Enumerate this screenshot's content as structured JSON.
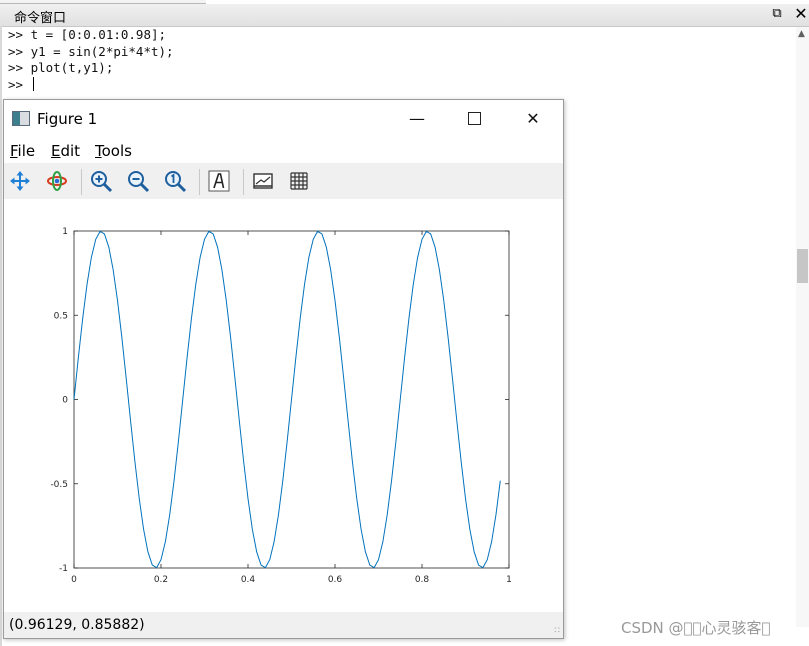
{
  "command_window": {
    "title": "命令窗口",
    "lines": [
      ">> t = [0:0.01:0.98];",
      ">> y1 = sin(2*pi*4*t);",
      ">> plot(t,y1);",
      ">> "
    ],
    "close_glyph": "✕"
  },
  "figure": {
    "title": "Figure 1",
    "menu": {
      "file": "File",
      "edit": "Edit",
      "tools": "Tools"
    },
    "toolbar": [
      "pan-icon",
      "rotate-icon",
      "zoom-in-icon",
      "zoom-out-icon",
      "zoom-reset-icon",
      "insert-text-icon",
      "toggle-axes-icon",
      "toggle-grid-icon"
    ],
    "status": "(0.96129, 0.85882)",
    "line_color": "#0072bd"
  },
  "watermark": "CSDN @\u0000\u0000心灵骇客\u0000",
  "chart_data": {
    "type": "line",
    "expression": "y1 = sin(2*pi*4*t)",
    "x_start": 0,
    "x_step": 0.01,
    "x_end": 0.98,
    "frequency": 4,
    "xlim": [
      0,
      1
    ],
    "ylim": [
      -1,
      1
    ],
    "xticks": [
      0,
      0.2,
      0.4,
      0.6,
      0.8,
      1
    ],
    "xtick_labels": [
      "0",
      "0.2",
      "0.4",
      "0.6",
      "0.8",
      "1"
    ],
    "yticks": [
      -1,
      -0.5,
      0,
      0.5,
      1
    ],
    "ytick_labels": [
      "-1",
      "-0.5",
      "0",
      "0.5",
      "1"
    ],
    "grid": false,
    "title": "",
    "xlabel": "",
    "ylabel": ""
  }
}
